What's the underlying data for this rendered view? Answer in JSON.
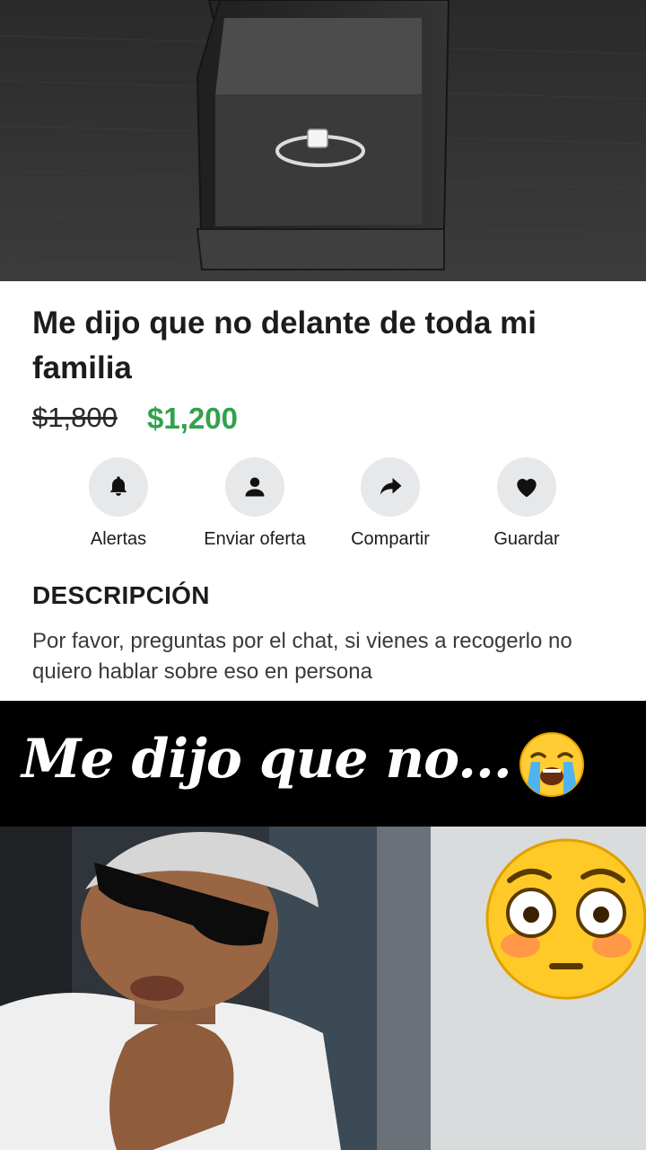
{
  "listing": {
    "title": "Me dijo que no delante de toda mi familia",
    "price_original": "$1,800",
    "price_current": "$1,200",
    "price_color": "#31a24c",
    "actions": [
      {
        "label": "Alertas",
        "icon": "bell-icon"
      },
      {
        "label": "Enviar oferta",
        "icon": "person-icon"
      },
      {
        "label": "Compartir",
        "icon": "share-arrow-icon"
      },
      {
        "label": "Guardar",
        "icon": "heart-icon"
      }
    ],
    "description_heading": "DESCRIPCIÓN",
    "description_text": "Por favor, preguntas por el chat, si vienes a recogerlo no quiero hablar sobre eso en persona"
  },
  "caption": {
    "text": "Me dijo que no...",
    "emoji": "loudly-crying-face-emoji"
  },
  "overlay": {
    "emoji": "flushed-face-emoji"
  }
}
